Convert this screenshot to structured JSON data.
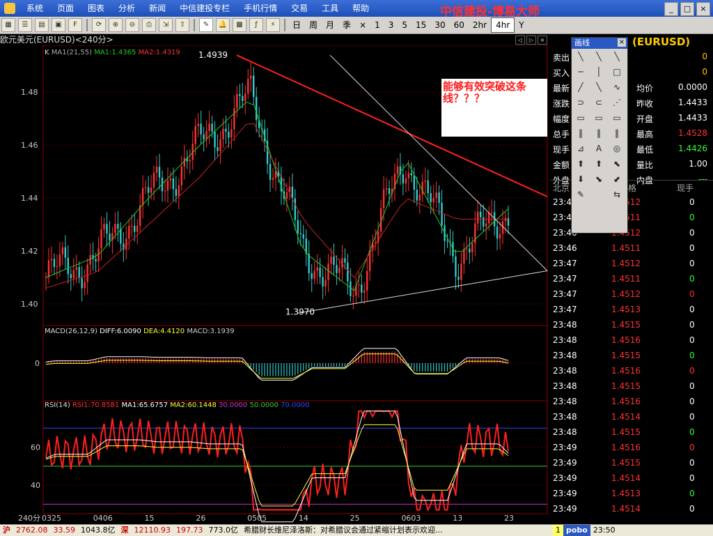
{
  "menu": {
    "items": [
      "系统",
      "页面",
      "图表",
      "分析",
      "新闻",
      "中信建投专栏",
      "手机行情",
      "交易",
      "工具",
      "帮助"
    ],
    "brand": "中信建投-博易大师",
    "window_buttons": [
      "_",
      "□",
      "×"
    ]
  },
  "toolbar": {
    "periods": [
      "日",
      "周",
      "月",
      "季",
      "×",
      "1",
      "3",
      "5",
      "15",
      "30",
      "60",
      "2hr",
      "4hr",
      "Y"
    ],
    "active_period": "4hr"
  },
  "panel": {
    "title": "欧元美元(EURUSD)<240分>",
    "title_buttons": [
      "◁",
      "▷",
      "×"
    ]
  },
  "main_legend": {
    "k": "K",
    "ma1": "MA1(21,55)",
    "ma1v": "MA1:1.4365",
    "ma2v": "MA2:1.4319"
  },
  "macd_legend": {
    "name": "MACD(26,12,9)",
    "diff": "DIFF:6.0090",
    "dea": "DEA:4.4120",
    "macd": "MACD:3.1939"
  },
  "rsi_legend": {
    "name": "RSI(14)",
    "rsi1": "RSI1:70.8581",
    "ma1": "MA1:65.6757",
    "ma2": "MA2:60.1448",
    "l30": "30.0000",
    "l50": "50.0000",
    "l70": "70.0000"
  },
  "annotations": {
    "high": "1.4939",
    "low": "1.3970",
    "note": "能够有效突破这条线？？？"
  },
  "axes": {
    "price_ticks": [
      "1.48",
      "1.46",
      "1.44",
      "1.42",
      "1.40"
    ],
    "macd_ticks": [
      "0"
    ],
    "rsi_ticks": [
      "60",
      "40"
    ],
    "x_period_label": "240分",
    "x_ticks": [
      "0325",
      "0406",
      "15",
      "26",
      "0505",
      "14",
      "25",
      "0603",
      "13",
      "23"
    ]
  },
  "chart_data": {
    "type": "line",
    "title": "",
    "xlabel": "",
    "ylabel": "",
    "x": [
      "0325",
      "0406",
      "15",
      "26",
      "0505",
      "14",
      "25",
      "0603",
      "13",
      "23"
    ],
    "ylim": [
      1.395,
      1.495
    ],
    "series": [
      {
        "name": "MA1",
        "values": [
          1.41,
          1.418,
          1.44,
          1.46,
          1.478,
          1.42,
          1.405,
          1.455,
          1.418,
          1.436
        ]
      },
      {
        "name": "MA2",
        "values": [
          1.406,
          1.412,
          1.43,
          1.448,
          1.47,
          1.432,
          1.41,
          1.44,
          1.432,
          1.432
        ]
      }
    ],
    "annotations": [
      "1.4939",
      "1.3970"
    ]
  },
  "right": {
    "symbol": "(EURUSD)",
    "quote_left": [
      {
        "label": "卖出",
        "value": "0"
      },
      {
        "label": "买入",
        "value": "0"
      },
      {
        "label": "最新",
        "value": ""
      },
      {
        "label": "涨跌",
        "value": ""
      },
      {
        "label": "幅度",
        "value": ""
      },
      {
        "label": "总手",
        "value": ""
      },
      {
        "label": "现手",
        "value": ""
      },
      {
        "label": "金额",
        "value": ""
      },
      {
        "label": "外盘",
        "value": ""
      }
    ],
    "quote_right": [
      {
        "label": "均价",
        "value": "0.0000",
        "color": "#ffffff"
      },
      {
        "label": "昨收",
        "value": "1.4433",
        "color": "#ffffff"
      },
      {
        "label": "开盘",
        "value": "1.4433",
        "color": "#ffffff"
      },
      {
        "label": "最高",
        "value": "1.4528",
        "color": "#ff3333"
      },
      {
        "label": "最低",
        "value": "1.4426",
        "color": "#33ff33"
      },
      {
        "label": "量比",
        "value": "1.00",
        "color": "#ffffff"
      },
      {
        "label": "内盘",
        "value": "---",
        "color": "#33ff33"
      }
    ],
    "trade_header": {
      "time": "北京",
      "price": "格",
      "vol": "现手"
    },
    "trades": [
      {
        "time": "23:48",
        "price": "1.4512",
        "vol": "0",
        "volcolor": "#ffffff"
      },
      {
        "time": "23:48",
        "price": "1.4511",
        "vol": "0",
        "volcolor": "#33ff33"
      },
      {
        "time": "23:46",
        "price": "1.4512",
        "vol": "0",
        "volcolor": "#ffffff"
      },
      {
        "time": "23:46",
        "price": "1.4511",
        "vol": "0",
        "volcolor": "#ffffff"
      },
      {
        "time": "23:47",
        "price": "1.4512",
        "vol": "0",
        "volcolor": "#ffffff"
      },
      {
        "time": "23:47",
        "price": "1.4511",
        "vol": "0",
        "volcolor": "#33ff33"
      },
      {
        "time": "23:47",
        "price": "1.4512",
        "vol": "0",
        "volcolor": "#ff3333"
      },
      {
        "time": "23:47",
        "price": "1.4513",
        "vol": "0",
        "volcolor": "#ffffff"
      },
      {
        "time": "23:48",
        "price": "1.4515",
        "vol": "0",
        "volcolor": "#ffffff"
      },
      {
        "time": "23:48",
        "price": "1.4516",
        "vol": "0",
        "volcolor": "#ffffff"
      },
      {
        "time": "23:48",
        "price": "1.4515",
        "vol": "0",
        "volcolor": "#33ff33"
      },
      {
        "time": "23:48",
        "price": "1.4516",
        "vol": "0",
        "volcolor": "#ff3333"
      },
      {
        "time": "23:48",
        "price": "1.4515",
        "vol": "0",
        "volcolor": "#ffffff"
      },
      {
        "time": "23:48",
        "price": "1.4516",
        "vol": "0",
        "volcolor": "#ffffff"
      },
      {
        "time": "23:48",
        "price": "1.4514",
        "vol": "0",
        "volcolor": "#ffffff"
      },
      {
        "time": "23:48",
        "price": "1.4515",
        "vol": "0",
        "volcolor": "#33ff33"
      },
      {
        "time": "23:49",
        "price": "1.4516",
        "vol": "0",
        "volcolor": "#ff3333"
      },
      {
        "time": "23:49",
        "price": "1.4515",
        "vol": "0",
        "volcolor": "#ffffff"
      },
      {
        "time": "23:49",
        "price": "1.4514",
        "vol": "0",
        "volcolor": "#ffffff"
      },
      {
        "time": "23:49",
        "price": "1.4513",
        "vol": "0",
        "volcolor": "#33ff33"
      },
      {
        "time": "23:49",
        "price": "1.4514",
        "vol": "0",
        "volcolor": "#ffffff"
      }
    ]
  },
  "draw_panel": {
    "title": "画线",
    "close": "×",
    "tools": [
      "╲",
      "╲",
      "╲",
      "─",
      "│",
      "□",
      "╱",
      "╲",
      "∿",
      "⊃",
      "⊂",
      "⋰",
      "▭",
      "▭",
      "▭",
      "‖",
      "‖",
      "‖",
      "⊿",
      "A",
      "◎",
      "⬆",
      "⬆",
      "⬉",
      "⬇",
      "⬊",
      "⬋",
      "✎",
      "",
      "⇆"
    ]
  },
  "status": {
    "market": "沪",
    "idx1": "2762.08",
    "chg1": "33.59",
    "amt1": "1043.8亿",
    "market2": "深",
    "idx2": "12110.93",
    "chg2": "197.73",
    "amt2": "773.0亿",
    "news": "希腊财长维尼泽洛斯：对希腊议会通过紧缩计划表示欢迎...",
    "alert": "1",
    "brand": "pobo",
    "time": "23:50"
  },
  "colors": {
    "up": "#ff3333",
    "down": "#33cccc",
    "ma1": "#22cc22",
    "ma2": "#cc2222",
    "trend": "#ff2020",
    "menu": "#2a58c4"
  }
}
